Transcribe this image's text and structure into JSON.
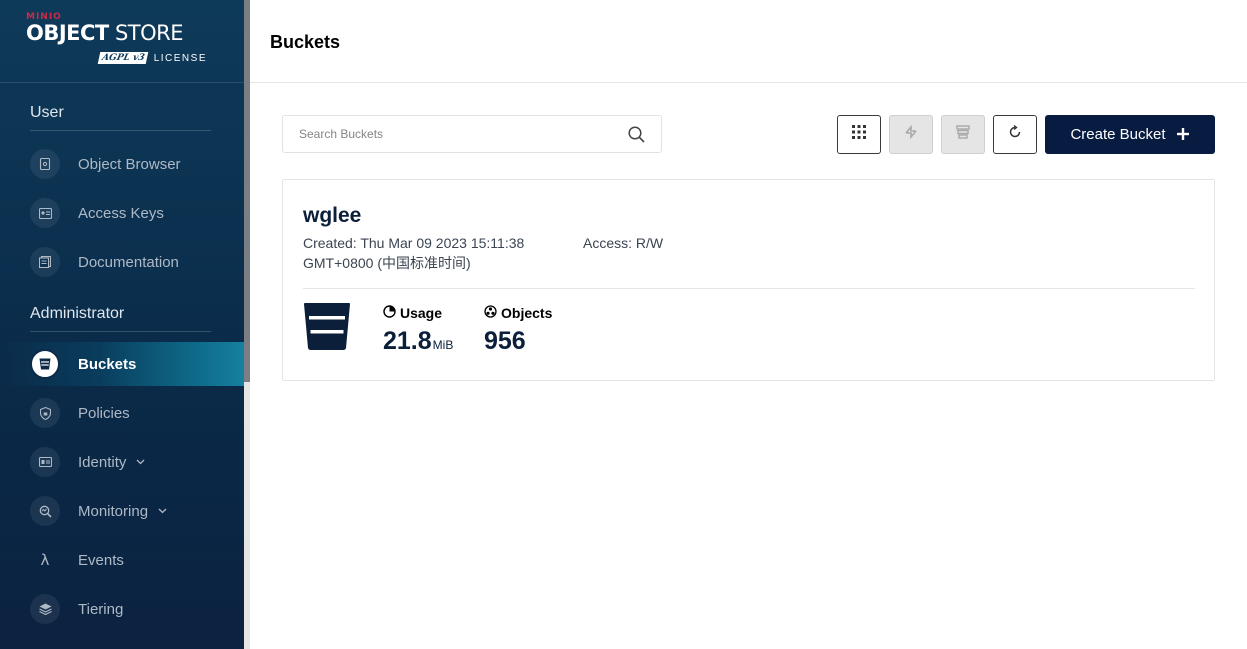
{
  "logo": {
    "brand": "MINIO",
    "title_bold": "OBJECT",
    "title_rest": " STORE",
    "badge": "AGPL v3",
    "license": "LICENSE"
  },
  "sidebar": {
    "user_section": "User",
    "admin_section": "Administrator",
    "user_items": [
      {
        "label": "Object Browser",
        "icon": "object-browser-icon"
      },
      {
        "label": "Access Keys",
        "icon": "access-keys-icon"
      },
      {
        "label": "Documentation",
        "icon": "documentation-icon"
      }
    ],
    "admin_items": [
      {
        "label": "Buckets",
        "icon": "bucket-icon",
        "active": true
      },
      {
        "label": "Policies",
        "icon": "shield-icon"
      },
      {
        "label": "Identity",
        "icon": "identity-icon",
        "expandable": true
      },
      {
        "label": "Monitoring",
        "icon": "monitoring-icon",
        "expandable": true
      },
      {
        "label": "Events",
        "icon": "lambda-icon",
        "glyph": "λ"
      },
      {
        "label": "Tiering",
        "icon": "tiering-icon"
      }
    ]
  },
  "header": {
    "title": "Buckets"
  },
  "toolbar": {
    "search_placeholder": "Search Buckets",
    "create_label": "Create Bucket"
  },
  "bucket": {
    "name": "wglee",
    "created_line1": "Created: Thu Mar 09 2023 15:11:38",
    "created_line2": "GMT+0800 (中国标准时间)",
    "access": "Access: R/W",
    "usage_label": "Usage",
    "usage_value": "21.8",
    "usage_unit": "MiB",
    "objects_label": "Objects",
    "objects_value": "956"
  },
  "colors": {
    "sidebar_bg": "#0e3a5a",
    "accent": "#081c42",
    "brand_red": "#c72c48"
  }
}
